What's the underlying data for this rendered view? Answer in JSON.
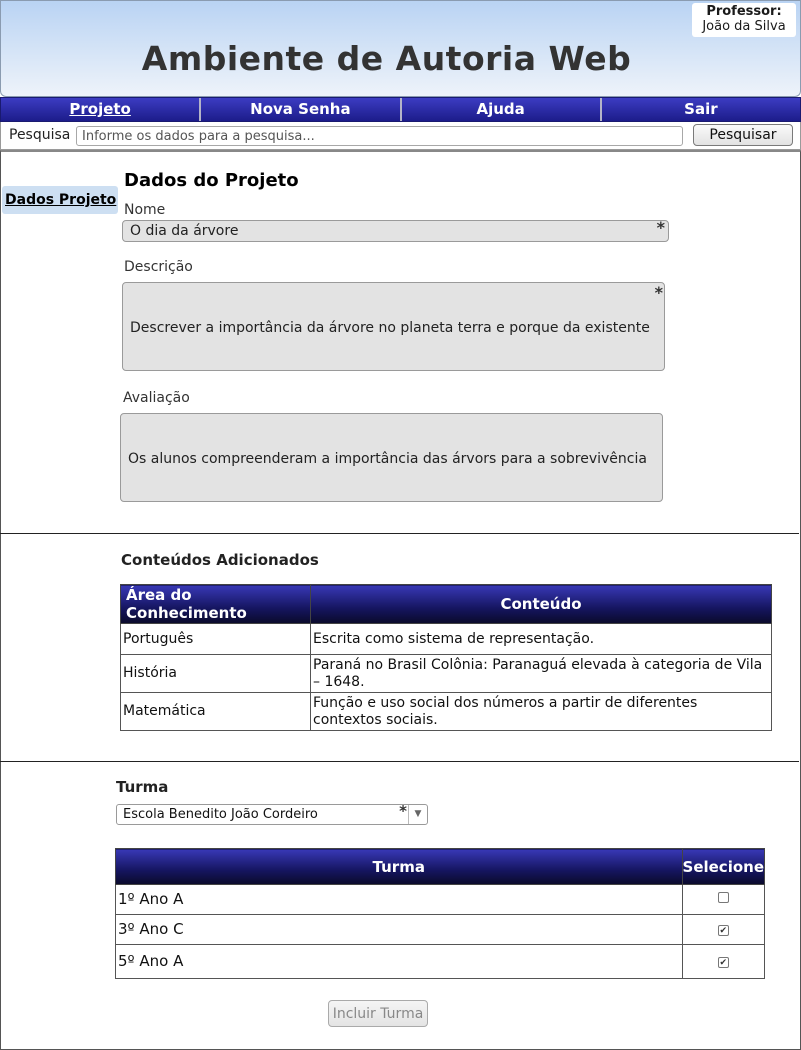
{
  "header": {
    "title": "Ambiente de Autoria Web",
    "professor_label": "Professor:",
    "professor_name": "João da Silva"
  },
  "nav": {
    "items": [
      {
        "label": "Projeto",
        "active": true
      },
      {
        "label": "Nova Senha",
        "active": false
      },
      {
        "label": "Ajuda",
        "active": false
      },
      {
        "label": "Sair",
        "active": false
      }
    ]
  },
  "search": {
    "label": "Pesquisa",
    "placeholder": "Informe os dados para a pesquisa...",
    "button_label": "Pesquisar"
  },
  "sidebar": {
    "tab_label": "Dados Projeto"
  },
  "project": {
    "section_title": "Dados do Projeto",
    "name_label": "Nome",
    "name_value": "O dia da árvore",
    "description_label": "Descrição",
    "description_value": "Descrever a importância da árvore no planeta terra e porque da existente",
    "evaluation_label": "Avaliação",
    "evaluation_value": "Os alunos compreenderam a importância das árvors para a sobrevivência",
    "required_mark": "*"
  },
  "contents": {
    "title": "Conteúdos  Adicionados",
    "columns": [
      "Área do Conhecimento",
      "Conteúdo"
    ],
    "rows": [
      {
        "area": "Português",
        "content": "Escrita como sistema de representação."
      },
      {
        "area": "História",
        "content": "Paraná no Brasil Colônia: Paranaguá elevada à categoria de Vila – 1648."
      },
      {
        "area": "Matemática",
        "content": "Função e uso social dos números a partir de diferentes contextos sociais."
      }
    ]
  },
  "classes": {
    "title": "Turma",
    "school_selected": "Escola Benedito João Cordeiro",
    "required_mark": "*",
    "columns": [
      "Turma",
      "Selecione"
    ],
    "rows": [
      {
        "name": "1º Ano A",
        "checked": false
      },
      {
        "name": "3º Ano C",
        "checked": true
      },
      {
        "name": "5º Ano A",
        "checked": true
      }
    ],
    "include_button_label": "Incluir Turma"
  }
}
